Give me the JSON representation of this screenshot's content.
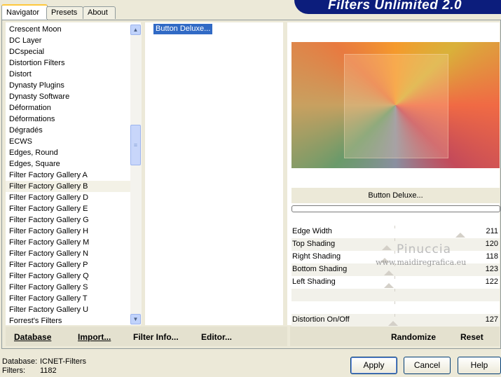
{
  "tabs": [
    {
      "label": "Navigator",
      "active": true
    },
    {
      "label": "Presets",
      "active": false
    },
    {
      "label": "About",
      "active": false
    }
  ],
  "brand": "Filters Unlimited 2.0",
  "categories": [
    "Crescent Moon",
    "DC Layer",
    "DCspecial",
    "Distortion Filters",
    "Distort",
    "Dynasty Plugins",
    "Dynasty Software",
    "Déformation",
    "Déformations",
    "Dégradés",
    "ECWS",
    "Edges, Round",
    "Edges, Square",
    "Filter Factory Gallery A",
    "Filter Factory Gallery B",
    "Filter Factory Gallery D",
    "Filter Factory Gallery E",
    "Filter Factory Gallery G",
    "Filter Factory Gallery H",
    "Filter Factory Gallery M",
    "Filter Factory Gallery N",
    "Filter Factory Gallery P",
    "Filter Factory Gallery Q",
    "Filter Factory Gallery S",
    "Filter Factory Gallery T",
    "Filter Factory Gallery U",
    "Forrest's Filters"
  ],
  "selected_category": "Filter Factory Gallery B",
  "filters": [
    "Button Deluxe..."
  ],
  "selected_filter": "Button Deluxe...",
  "preview_caption": "Button Deluxe...",
  "params": [
    {
      "label": "Edge Width",
      "value": "211",
      "level": 0.83
    },
    {
      "label": "Top Shading",
      "value": "120",
      "level": 0.47
    },
    {
      "label": "Right Shading",
      "value": "118",
      "level": 0.46
    },
    {
      "label": "Bottom Shading",
      "value": "123",
      "level": 0.48
    },
    {
      "label": "Left Shading",
      "value": "122",
      "level": 0.48
    },
    {
      "label": "",
      "value": ""
    },
    {
      "label": "",
      "value": ""
    },
    {
      "label": "Distortion On/Off",
      "value": "127",
      "level": 0.5
    }
  ],
  "watermark": {
    "name": "Pinuccia",
    "url": "www.maidiregrafica.eu"
  },
  "left_buttons": {
    "database": "Database",
    "import": "Import...",
    "filter_info": "Filter Info...",
    "editor": "Editor..."
  },
  "right_buttons": {
    "randomize": "Randomize",
    "reset": "Reset"
  },
  "status": {
    "database_label": "Database:",
    "database_value": "ICNET-Filters",
    "filters_label": "Filters:",
    "filters_value": "1182"
  },
  "dialog_buttons": {
    "apply": "Apply",
    "cancel": "Cancel",
    "help": "Help"
  },
  "colors": {
    "selection": "#316ac5",
    "brand_bg": "#0c1d7c",
    "dialog_bg": "#ece9d8"
  }
}
